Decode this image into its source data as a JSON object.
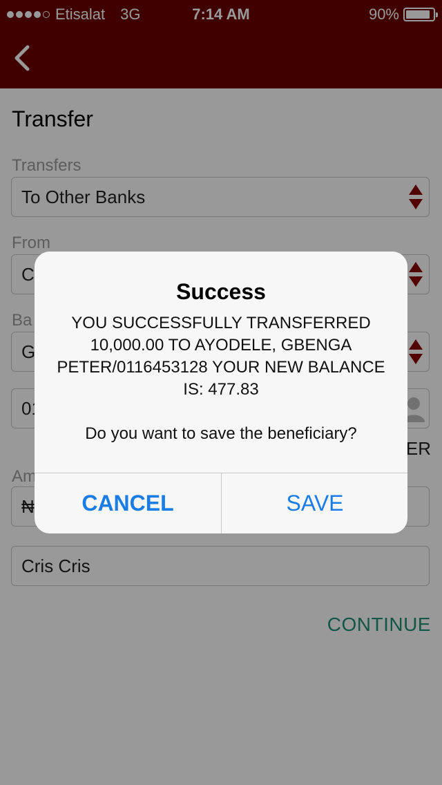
{
  "status_bar": {
    "carrier": "Etisalat",
    "network": "3G",
    "time": "7:14 AM",
    "battery": "90%",
    "battery_level": 0.9,
    "signal_bars_filled": 4,
    "signal_bars_total": 5
  },
  "nav": {
    "back_icon": "chevron-left-icon"
  },
  "page": {
    "title": "Transfer"
  },
  "form": {
    "transfers_label": "Transfers",
    "transfers_value": "To Other Banks",
    "from_label": "From",
    "from_value": "C",
    "bank_label": "Ba",
    "bank_value": "G",
    "account_value": "01",
    "beneficiary_side_text": "ER",
    "amount_label": "Am",
    "amount_value": "₦",
    "narration_value": "Cris Cris",
    "continue_label": "CONTINUE"
  },
  "alert": {
    "title": "Success",
    "message": "YOU SUCCESSFULLY TRANSFERRED 10,000.00 TO AYODELE, GBENGA PETER/0116453128 YOUR NEW BALANCE IS: 477.83",
    "question": "Do you want to save the beneficiary?",
    "cancel_label": "CANCEL",
    "save_label": "SAVE"
  },
  "colors": {
    "header": "#6b0000",
    "accent": "#1f9076",
    "alert_button": "#1a7de6",
    "stepper_arrow": "#8b0000"
  }
}
